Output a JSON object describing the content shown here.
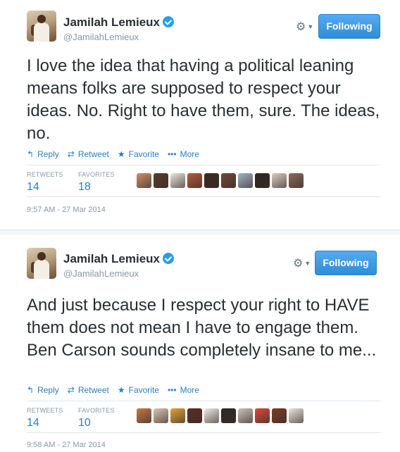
{
  "tweets": [
    {
      "author_name": "Jamilah Lemieux",
      "author_handle": "@JamilahLemieux",
      "follow_label": "Following",
      "text": "I love the idea that having a political leaning means folks are supposed to respect your ideas. No. Right to have them, sure. The ideas, no.",
      "actions": {
        "reply": "Reply",
        "retweet": "Retweet",
        "favorite": "Favorite",
        "more": "More"
      },
      "stats": {
        "retweets_label": "RETWEETS",
        "retweets": "14",
        "favorites_label": "FAVORITES",
        "favorites": "18"
      },
      "favoriter_avatar_colors": [
        "#c98f6b",
        "#5a3b2e",
        "#e8e4de",
        "#b45a3c",
        "#3b2a24",
        "#6f4a3a",
        "#9fb4c8",
        "#2f2521",
        "#d8cfc5",
        "#8a6b5a"
      ],
      "timestamp": "9:57 AM - 27 Mar 2014"
    },
    {
      "author_name": "Jamilah Lemieux",
      "author_handle": "@JamilahLemieux",
      "follow_label": "Following",
      "text": "And just because I respect your right to HAVE them does not mean I have to engage them. Ben Carson sounds completely insane to me...",
      "actions": {
        "reply": "Reply",
        "retweet": "Retweet",
        "favorite": "Favorite",
        "more": "More"
      },
      "stats": {
        "retweets_label": "RETWEETS",
        "retweets": "14",
        "favorites_label": "FAVORITES",
        "favorites": "10"
      },
      "favoriter_avatar_colors": [
        "#c27a4a",
        "#d8c7b1",
        "#e0a33c",
        "#5b2f25",
        "#f0ece6",
        "#2e2a28",
        "#c9c2bd",
        "#d94a3a",
        "#7a3d2c",
        "#e9e6e2"
      ],
      "timestamp": "9:58 AM - 27 Mar 2014"
    }
  ],
  "icons": {
    "verified": "verified-badge-icon",
    "gear": "gear-icon",
    "reply": "reply-arrow-icon",
    "retweet": "retweet-icon",
    "favorite": "star-icon",
    "more": "ellipsis-icon"
  },
  "colors": {
    "accent": "#2a7fc1",
    "follow_button": "#3a97d9",
    "muted": "#8899a6",
    "text": "#292f33"
  }
}
